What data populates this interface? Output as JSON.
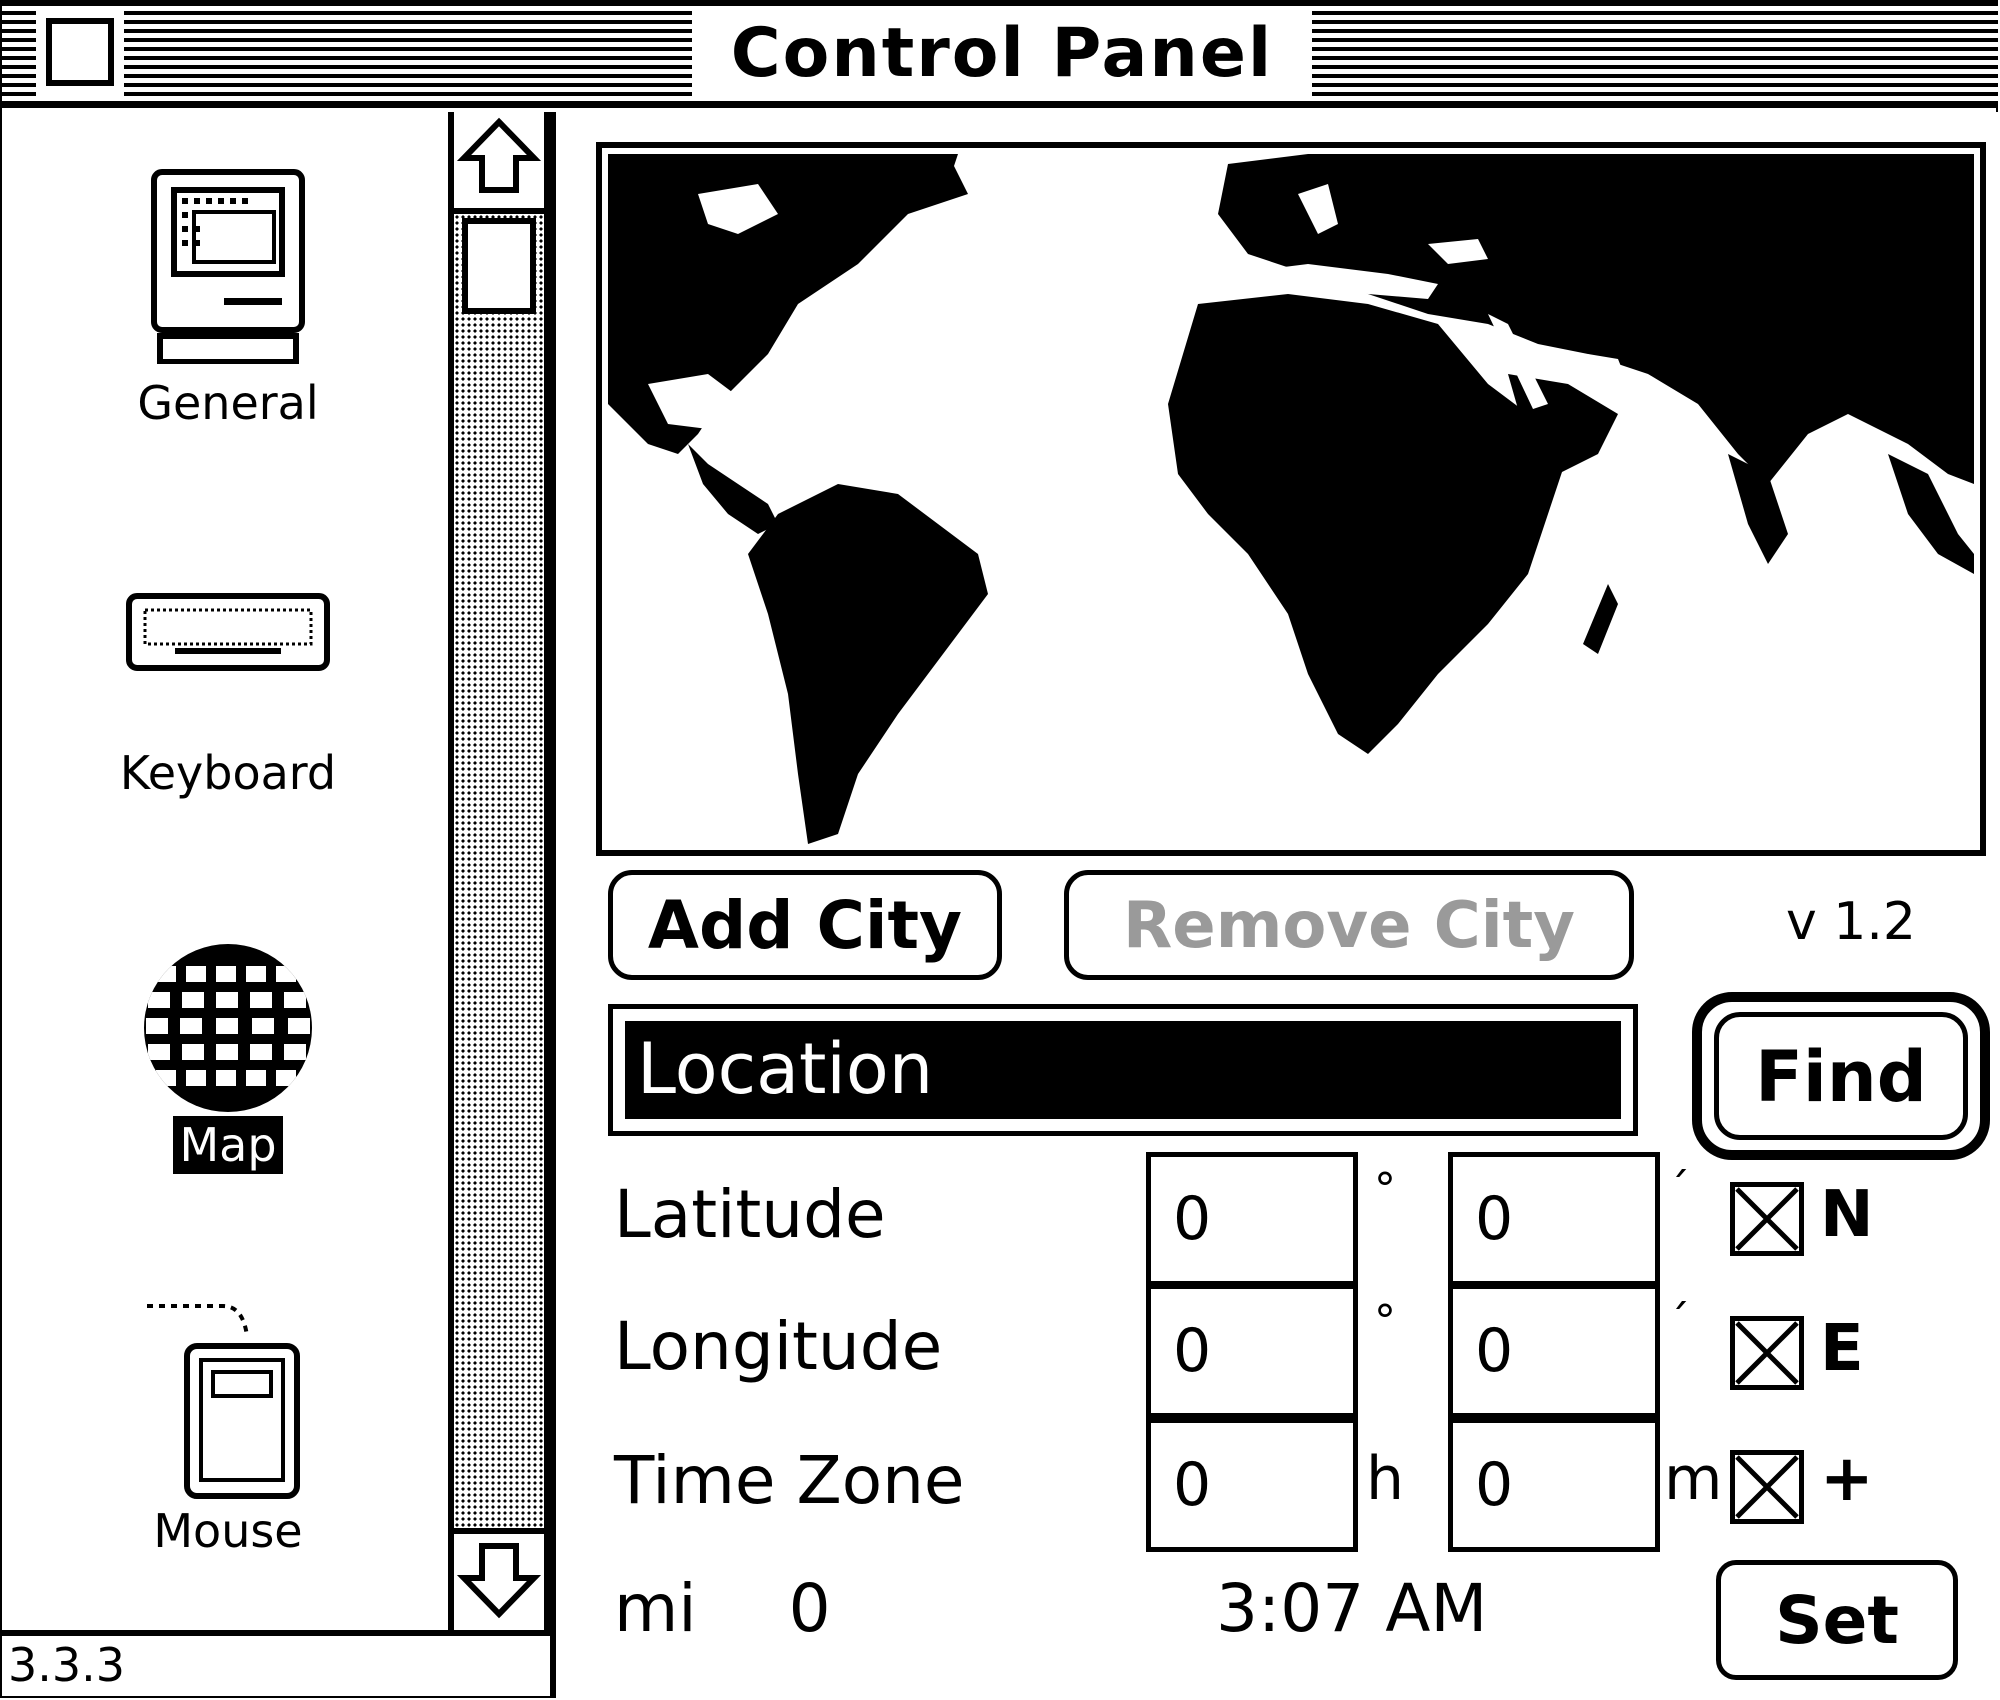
{
  "window": {
    "title": "Control Panel"
  },
  "sidebar": {
    "items": [
      {
        "label": "General",
        "icon": "macintosh-icon"
      },
      {
        "label": "Keyboard",
        "icon": "keyboard-icon"
      },
      {
        "label": "Map",
        "icon": "globe-icon",
        "selected": true
      },
      {
        "label": "Mouse",
        "icon": "mouse-icon"
      }
    ],
    "version": "3.3.3"
  },
  "map_panel": {
    "add_city_label": "Add City",
    "remove_city_label": "Remove City",
    "version_label": "v 1.2",
    "location_value": "Location",
    "find_label": "Find",
    "latitude": {
      "label": "Latitude",
      "degrees": "0",
      "minutes": "0",
      "degree_unit": "°",
      "minute_unit": "´",
      "dir_label": "N",
      "dir_checked": true
    },
    "longitude": {
      "label": "Longitude",
      "degrees": "0",
      "minutes": "0",
      "degree_unit": "°",
      "minute_unit": "´",
      "dir_label": "E",
      "dir_checked": true
    },
    "timezone": {
      "label": "Time Zone",
      "hours": "0",
      "minutes": "0",
      "hour_unit": "h",
      "minute_unit": "m",
      "sign_label": "+",
      "sign_checked": true
    },
    "distance_unit": "mi",
    "distance_value": "0",
    "time": "3:07 AM",
    "set_label": "Set"
  },
  "colors": {
    "foreground": "#000000",
    "background": "#ffffff",
    "disabled": "#9a9a9a"
  }
}
